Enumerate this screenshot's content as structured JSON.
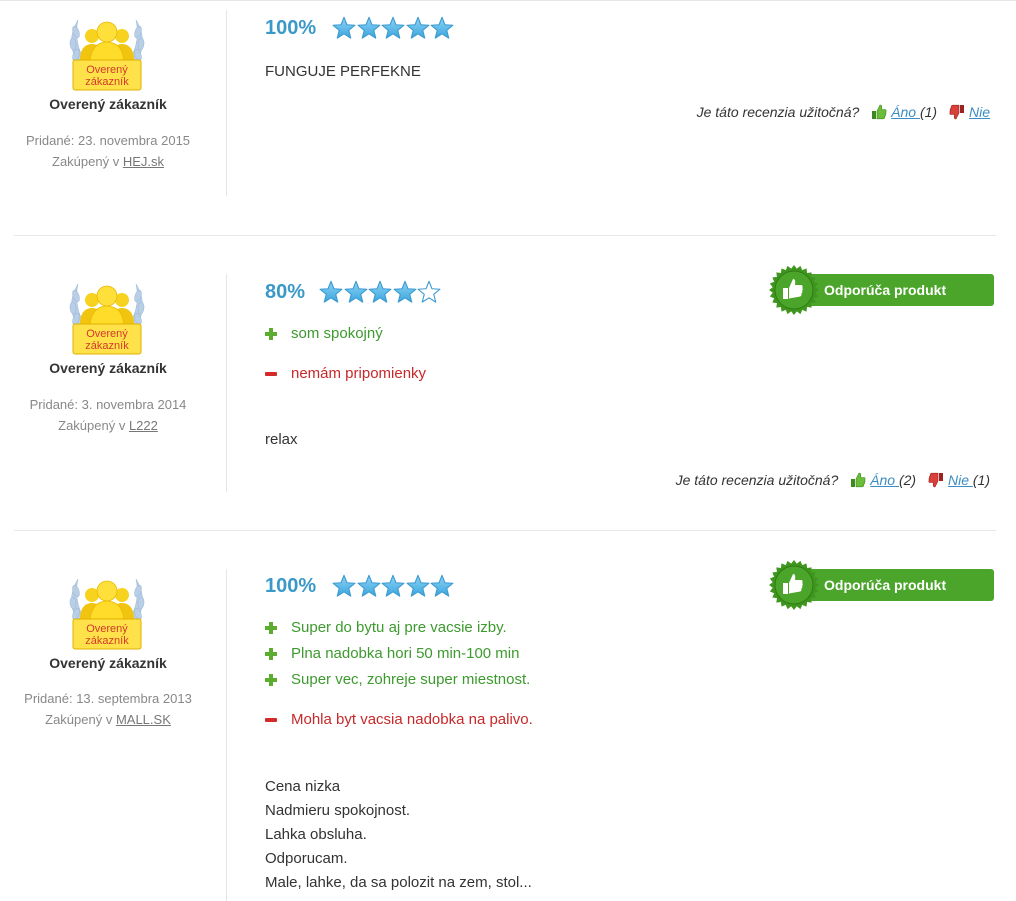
{
  "reviews": [
    {
      "badge_text": [
        "Overený",
        "zákazník"
      ],
      "author": "Overený zákazník",
      "added": "Pridané: 23. novembra 2015",
      "bought_prefix": "Zakúpený v ",
      "bought_store": "HEJ.sk",
      "score": "100%",
      "rating": 5,
      "recommend": "",
      "pros": [],
      "cons": [],
      "text": [
        "FUNGUJE PERFEKNE"
      ],
      "helpful_question": "Je táto recenzia užitočná?",
      "yes_label": "Áno ",
      "yes_count": "(1)",
      "no_label": "Nie",
      "no_count": ""
    },
    {
      "badge_text": [
        "Overený",
        "zákazník"
      ],
      "author": "Overený zákazník",
      "added": "Pridané: 3. novembra 2014",
      "bought_prefix": "Zakúpený v ",
      "bought_store": "L222",
      "score": "80%",
      "rating": 4,
      "recommend": "Odporúča produkt",
      "pros": [
        "som spokojný"
      ],
      "cons": [
        "nemám pripomienky"
      ],
      "text": [
        "relax"
      ],
      "helpful_question": "Je táto recenzia užitočná?",
      "yes_label": "Áno ",
      "yes_count": "(2)",
      "no_label": "Nie ",
      "no_count": "(1)"
    },
    {
      "badge_text": [
        "Overený",
        "zákazník"
      ],
      "author": "Overený zákazník",
      "added": "Pridané: 13. septembra 2013",
      "bought_prefix": "Zakúpený v ",
      "bought_store": "MALL.SK",
      "score": "100%",
      "rating": 5,
      "recommend": "Odporúča produkt",
      "pros": [
        "Super do bytu aj pre vacsie izby.",
        "Plna nadobka hori 50 min-100 min",
        "Super vec, zohreje super miestnost."
      ],
      "cons": [
        "Mohla byt vacsia nadobka na palivo."
      ],
      "text": [
        "Cena nizka",
        "Nadmieru spokojnost.",
        "Lahka obsluha.",
        "Odporucam.",
        "Male, lahke, da sa polozit na zem, stol..."
      ],
      "helpful_question": "",
      "yes_label": "",
      "yes_count": "",
      "no_label": "",
      "no_count": ""
    }
  ],
  "colors": {
    "score": "#3b99c9",
    "pro": "#3d9a2e",
    "con": "#c8282a",
    "link": "#3b8dc4",
    "recommend": "#4ba52b",
    "star": "#5bb8e8"
  },
  "icons": {
    "badge": "verified-customer-badge-icon",
    "thumb_up": "thumb-up-icon",
    "thumb_down": "thumb-down-icon",
    "pro": "plus-icon",
    "con": "minus-icon",
    "star": "star-icon"
  }
}
